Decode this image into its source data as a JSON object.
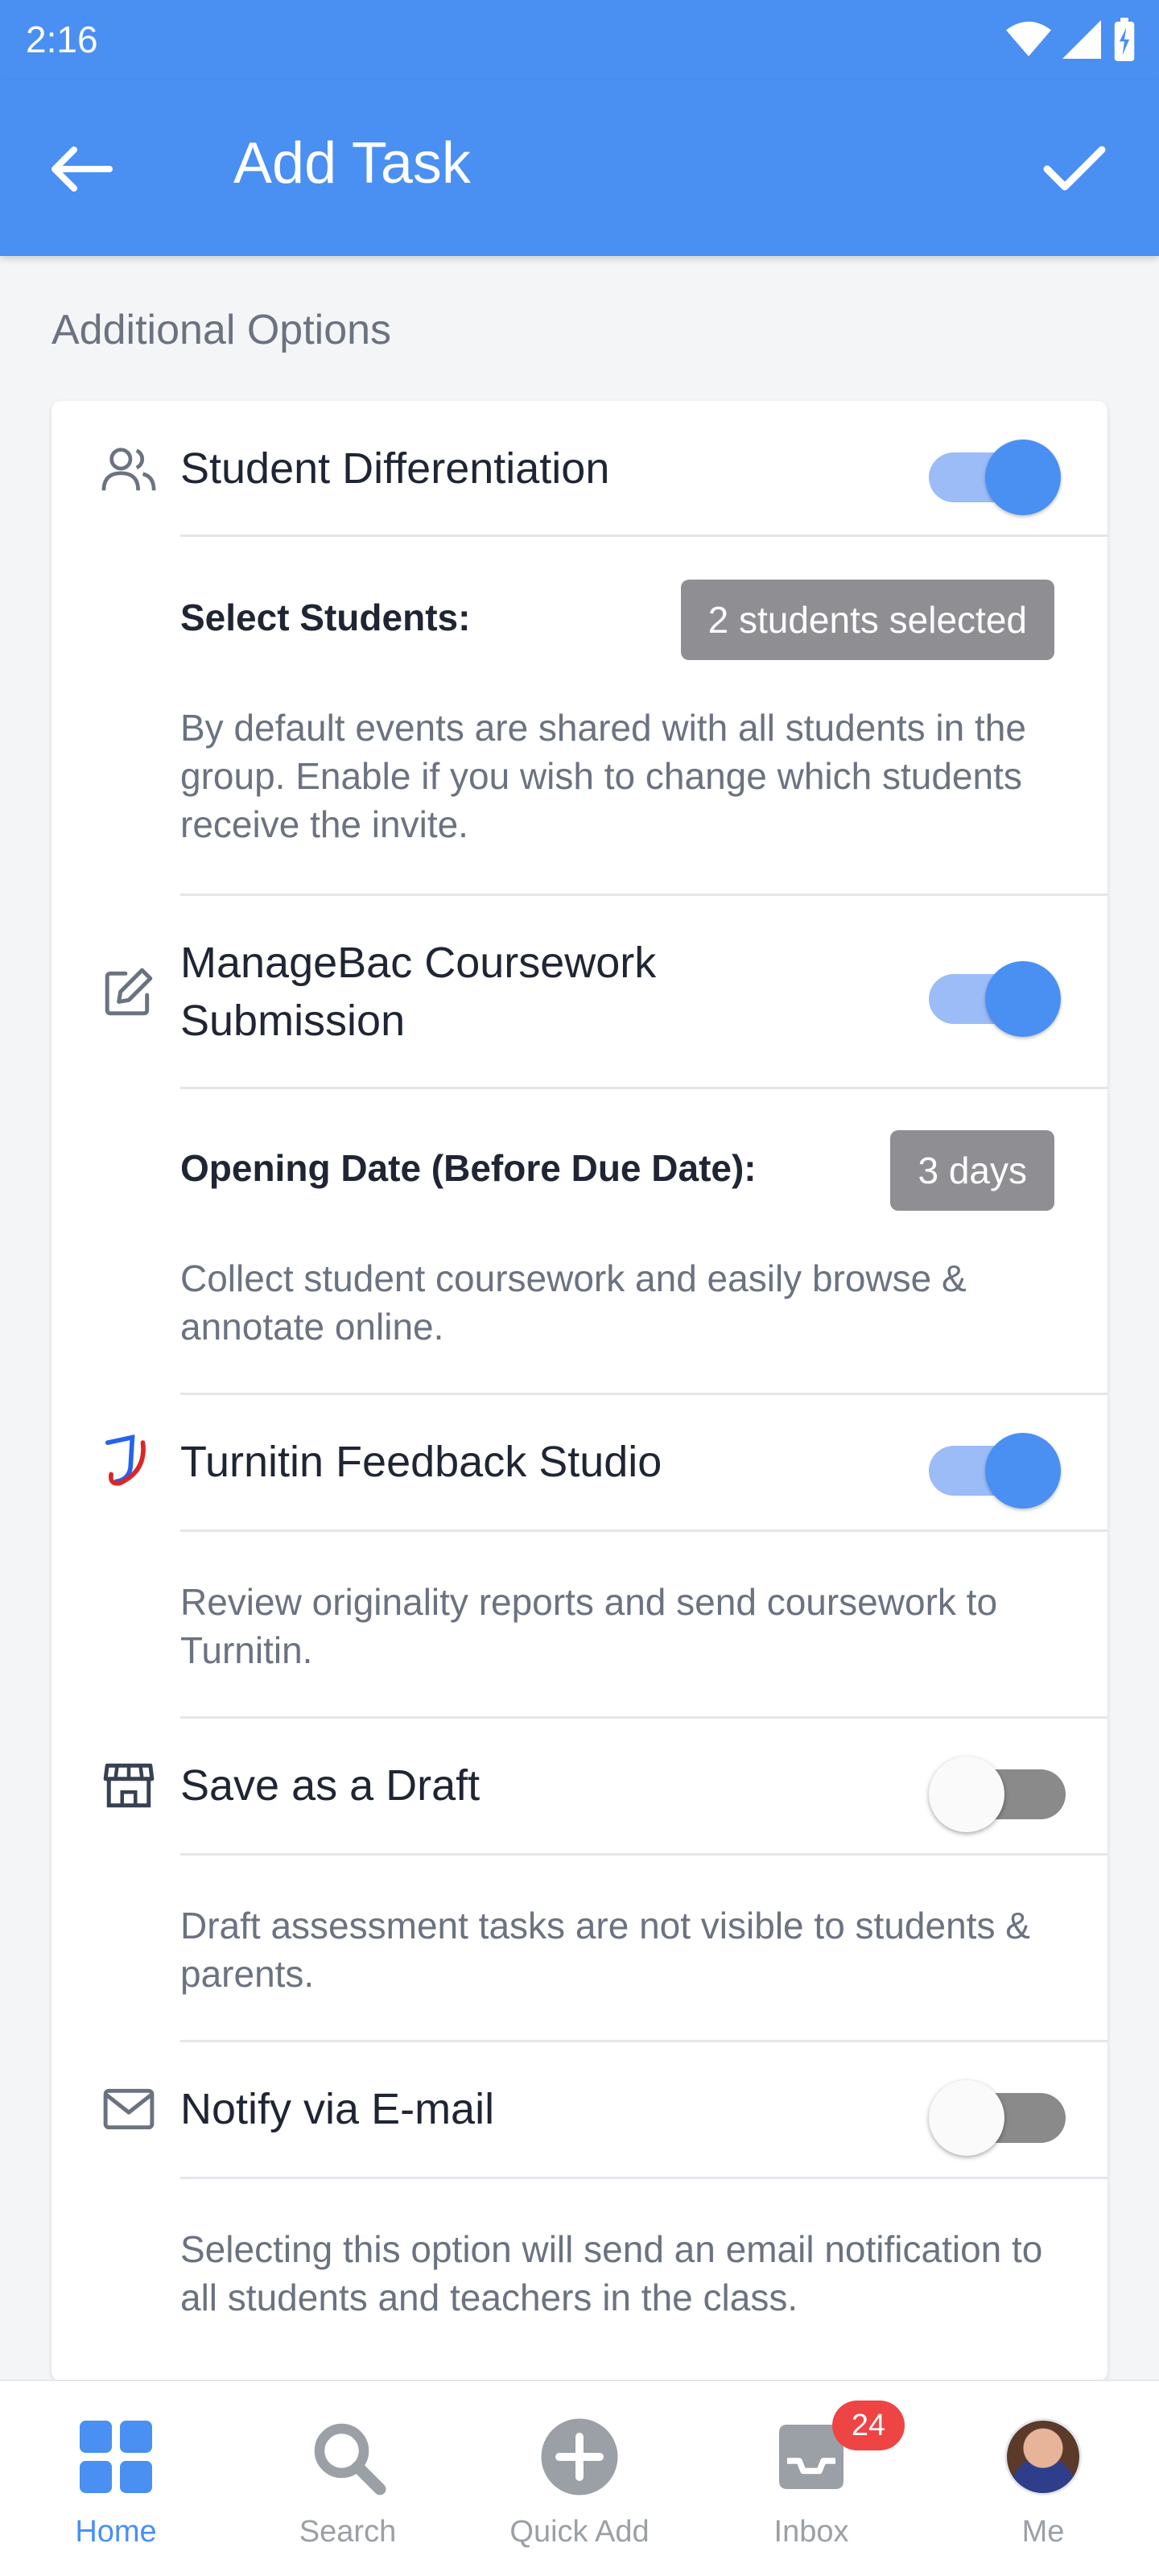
{
  "status_bar": {
    "time": "2:16"
  },
  "app_bar": {
    "title": "Add Task"
  },
  "section": {
    "title": "Additional Options"
  },
  "options": {
    "differentiation": {
      "title": "Student Differentiation",
      "enabled": true,
      "select_label": "Select Students:",
      "select_value": "2 students selected",
      "description": "By default events are shared with all students in the group. Enable if you wish to change which students receive the invite."
    },
    "coursework": {
      "title": "ManageBac Coursework Submission",
      "enabled": true,
      "opening_label": "Opening Date (Before Due Date):",
      "opening_value": "3 days",
      "description": "Collect student coursework and easily browse & annotate online."
    },
    "turnitin": {
      "title": "Turnitin Feedback Studio",
      "enabled": true,
      "description": "Review originality reports and send coursework to Turnitin."
    },
    "draft": {
      "title": "Save as a Draft",
      "enabled": false,
      "description": "Draft assessment tasks are not visible to students & parents."
    },
    "email": {
      "title": "Notify via E-mail",
      "enabled": false,
      "description": "Selecting this option will send an email notification to all students and teachers in the class."
    }
  },
  "bottom_nav": {
    "items": [
      {
        "label": "Home",
        "icon": "home-grid-icon",
        "active": true
      },
      {
        "label": "Search",
        "icon": "search-icon",
        "active": false
      },
      {
        "label": "Quick Add",
        "icon": "plus-circle-icon",
        "active": false
      },
      {
        "label": "Inbox",
        "icon": "inbox-icon",
        "active": false
      },
      {
        "label": "Me",
        "icon": "avatar",
        "active": false
      }
    ],
    "inbox_badge": "24"
  },
  "colors": {
    "primary": "#4a8ff2",
    "badge": "#ef4444",
    "pill": "#8e8e93"
  }
}
